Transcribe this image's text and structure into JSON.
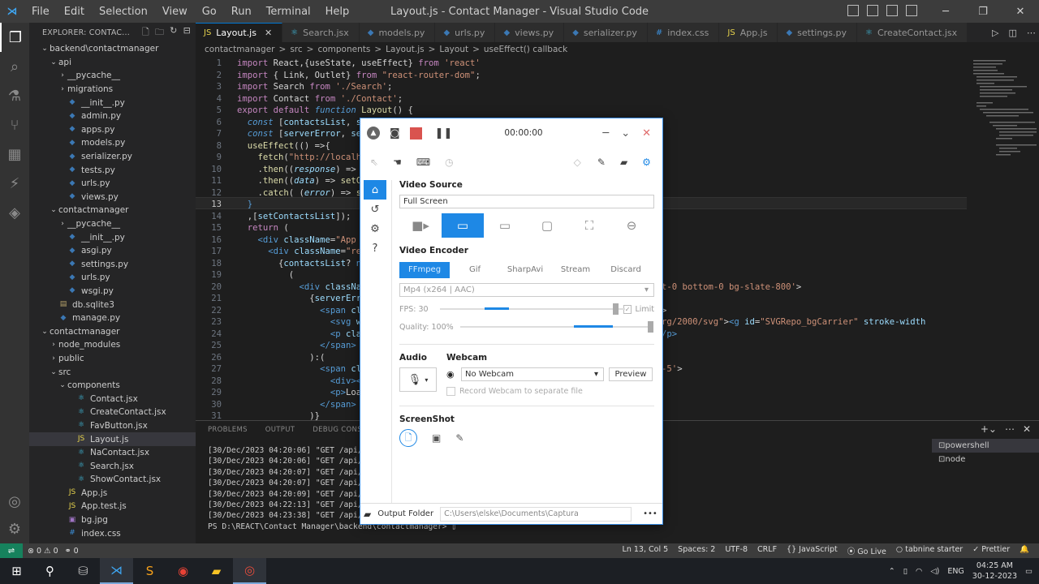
{
  "titlebar": {
    "menus": [
      "File",
      "Edit",
      "Selection",
      "View",
      "Go",
      "Run",
      "Terminal",
      "Help"
    ],
    "title": "Layout.js - Contact Manager - Visual Studio Code"
  },
  "explorer": {
    "header": "EXPLORER: CONTAC...",
    "items": [
      {
        "label": "backend\\contactmanager",
        "indent": 1,
        "type": "folder",
        "open": true
      },
      {
        "label": "api",
        "indent": 2,
        "type": "folder",
        "open": true
      },
      {
        "label": "__pycache__",
        "indent": 3,
        "type": "folder",
        "open": false
      },
      {
        "label": "migrations",
        "indent": 3,
        "type": "folder",
        "open": false
      },
      {
        "label": "__init__.py",
        "indent": 3,
        "type": "py"
      },
      {
        "label": "admin.py",
        "indent": 3,
        "type": "py"
      },
      {
        "label": "apps.py",
        "indent": 3,
        "type": "py"
      },
      {
        "label": "models.py",
        "indent": 3,
        "type": "py"
      },
      {
        "label": "serializer.py",
        "indent": 3,
        "type": "py"
      },
      {
        "label": "tests.py",
        "indent": 3,
        "type": "py"
      },
      {
        "label": "urls.py",
        "indent": 3,
        "type": "py"
      },
      {
        "label": "views.py",
        "indent": 3,
        "type": "py"
      },
      {
        "label": "contactmanager",
        "indent": 2,
        "type": "folder",
        "open": true
      },
      {
        "label": "__pycache__",
        "indent": 3,
        "type": "folder",
        "open": false
      },
      {
        "label": "__init__.py",
        "indent": 3,
        "type": "py"
      },
      {
        "label": "asgi.py",
        "indent": 3,
        "type": "py"
      },
      {
        "label": "settings.py",
        "indent": 3,
        "type": "py"
      },
      {
        "label": "urls.py",
        "indent": 3,
        "type": "py"
      },
      {
        "label": "wsgi.py",
        "indent": 3,
        "type": "py"
      },
      {
        "label": "db.sqlite3",
        "indent": 2,
        "type": "db"
      },
      {
        "label": "manage.py",
        "indent": 2,
        "type": "py"
      },
      {
        "label": "contactmanager",
        "indent": 1,
        "type": "folder",
        "open": true
      },
      {
        "label": "node_modules",
        "indent": 2,
        "type": "folder",
        "open": false
      },
      {
        "label": "public",
        "indent": 2,
        "type": "folder",
        "open": false
      },
      {
        "label": "src",
        "indent": 2,
        "type": "folder",
        "open": true
      },
      {
        "label": "components",
        "indent": 3,
        "type": "folder",
        "open": true
      },
      {
        "label": "Contact.jsx",
        "indent": 4,
        "type": "jsx"
      },
      {
        "label": "CreateContact.jsx",
        "indent": 4,
        "type": "jsx"
      },
      {
        "label": "FavButton.jsx",
        "indent": 4,
        "type": "jsx"
      },
      {
        "label": "Layout.js",
        "indent": 4,
        "type": "js",
        "selected": true
      },
      {
        "label": "NaContact.jsx",
        "indent": 4,
        "type": "jsx"
      },
      {
        "label": "Search.jsx",
        "indent": 4,
        "type": "jsx"
      },
      {
        "label": "ShowContact.jsx",
        "indent": 4,
        "type": "jsx"
      },
      {
        "label": "App.js",
        "indent": 3,
        "type": "js"
      },
      {
        "label": "App.test.js",
        "indent": 3,
        "type": "js"
      },
      {
        "label": "bg.jpg",
        "indent": 3,
        "type": "img"
      },
      {
        "label": "index.css",
        "indent": 3,
        "type": "css"
      }
    ]
  },
  "tabs": [
    {
      "label": "Layout.js",
      "icon": "JS",
      "active": true
    },
    {
      "label": "Search.jsx",
      "icon": "⚛"
    },
    {
      "label": "models.py",
      "icon": "◆"
    },
    {
      "label": "urls.py",
      "icon": "◆"
    },
    {
      "label": "views.py",
      "icon": "◆"
    },
    {
      "label": "serializer.py",
      "icon": "◆"
    },
    {
      "label": "index.css",
      "icon": "#"
    },
    {
      "label": "App.js",
      "icon": "JS"
    },
    {
      "label": "settings.py",
      "icon": "◆"
    },
    {
      "label": "CreateContact.jsx",
      "icon": "⚛"
    }
  ],
  "breadcrumb": [
    "contactmanager",
    ">",
    "src",
    ">",
    "components",
    ">",
    "Layout.js",
    ">",
    "Layout",
    ">",
    "useEffect() callback"
  ],
  "code": [
    "<span class='kw'>import</span> React,{useState, useEffect} <span class='kw'>from</span> <span class='str'>'react'</span>",
    "<span class='kw'>import</span> { Link, Outlet} <span class='kw'>from</span> <span class='str'>\"react-router-dom\"</span>;",
    "<span class='kw'>import</span> Search <span class='kw'>from</span> <span class='str'>'./Search'</span>;",
    "<span class='kw'>import</span> Contact <span class='kw'>from</span> <span class='str'>'./Contact'</span>;",
    "<span class='kw'>export default</span> <span class='kw2'><i>function</i></span> <span class='fn'>Layout</span>() {",
    "  <span class='kw2'><i>const</i></span> [<span class='var'>contactsList</span>, <span class='var'>set</span>",
    "  <span class='kw2'><i>const</i></span> [<span class='var'>serverError</span>, <span class='var'>setS</span>",
    "  <span class='fn'>useEffect</span>(() =>{",
    "    <span class='fn'>fetch</span>(<span class='str'>\"http://localhos</span>",
    "    .<span class='fn'>then</span>((<span class='var'><i>response</i></span>) => <span class='var'>re</span>",
    "    .<span class='fn'>then</span>((<span class='var'><i>data</i></span>) => <span class='fn'>setCor</span>",
    "    .<span class='fn'>catch</span>( (<span class='var'><i>error</i></span>) => <span class='fn'>set</span>",
    "  <span class='kw2'>}</span>",
    "  ,[<span class='var'>setContactsList</span>]);",
    "  <span class='kw'>return</span> (",
    "    <span class='tag'>&lt;div</span> <span class='var'>className</span>=<span class='str'>\"App h-</span>",
    "      <span class='tag'>&lt;div</span> <span class='var'>className</span>=<span class='str'>\"rela</span>",
    "        {<span class='var'>contactsList</span>? <span class='kw2'>nul</span>",
    "          (",
    "            <span class='tag'>&lt;div</span> <span class='var'>classNam</span>                                                <span class='str'>ft-0 right-0 bottom-0 bg-slate-800'</span>&gt;",
    "              {<span class='var'>serverErro</span>",
    "                <span class='tag'>&lt;span</span> <span class='var'>clas</span>                                           <span class='str'>lack gap-y-5'</span>&gt;",
    "                  <span class='tag'>&lt;svg</span> <span class='var'>wid</span>                                          <span class='str'>ttp://www.w3.org/2000/svg\"</span>&gt;<span class='tag'>&lt;g</span> <span class='var'>id</span>=<span class='str'>\"SVGRepo_bgCarrier\"</span> <span class='var'>stroke-width</span>",
    "                  <span class='tag'>&lt;p</span> <span class='var'>class</span>                                            the server.<span class='tag'>&lt;/p&gt;</span>",
    "                <span class='tag'>&lt;/span&gt;</span>",
    "              ):(",
    "                <span class='tag'>&lt;span</span> <span class='var'>clas</span>                                           <span class='str'>ose-500 gap-y-5'</span>&gt;",
    "                  <span class='tag'>&lt;div&gt;&lt;/</span>",
    "                  <span class='tag'>&lt;p&gt;</span>Loadi",
    "                <span class='tag'>&lt;/span&gt;</span>",
    "              )}"
  ],
  "panel": {
    "tabs": [
      "PROBLEMS",
      "OUTPUT",
      "DEBUG CONSOLE"
    ],
    "terminal_lines": [
      "[30/Dec/2023 04:20:06] \"GET /api/v1",
      "[30/Dec/2023 04:20:06] \"GET /api/v1",
      "[30/Dec/2023 04:20:07] \"GET /api/v1",
      "[30/Dec/2023 04:20:07] \"GET /api/v1",
      "[30/Dec/2023 04:20:09] \"GET /api/v1",
      "[30/Dec/2023 04:22:13] \"GET /api/v1",
      "[30/Dec/2023 04:23:38] \"GET /api/v1",
      "PS D:\\REACT\\Contact Manager\\backend\\contactmanager> ▯"
    ],
    "terminals": [
      "powershell",
      "node"
    ]
  },
  "statusbar": {
    "problems": "⊗ 0 ⚠ 0",
    "ports": "⚭ 0",
    "items": [
      "Ln 13, Col 5",
      "Spaces: 2",
      "UTF-8",
      "CRLF",
      "{} JavaScript",
      "⦿ Go Live",
      "○ tabnine starter",
      "✓ Prettier"
    ]
  },
  "taskbar": {
    "lang": "ENG",
    "time": "04:25 AM",
    "date": "30-12-2023"
  },
  "captura": {
    "timer": "00:00:00",
    "video_source_label": "Video Source",
    "video_source_value": "Full Screen",
    "video_encoder_label": "Video Encoder",
    "encoder_tabs": [
      "FFmpeg",
      "Gif",
      "SharpAvi",
      "Stream",
      "Discard"
    ],
    "codec": "Mp4 (x264 | AAC)",
    "fps_label": "FPS:",
    "fps_value": "30",
    "limit_label": "Limit",
    "quality_label": "Quality:",
    "quality_value": "100%",
    "audio_label": "Audio",
    "webcam_label": "Webcam",
    "webcam_value": "No Webcam",
    "preview_label": "Preview",
    "record_webcam_label": "Record Webcam to separate file",
    "screenshot_label": "ScreenShot",
    "output_folder_label": "Output Folder",
    "output_folder_path": "C:\\Users\\elske\\Documents\\Captura",
    "more_label": "•••"
  }
}
